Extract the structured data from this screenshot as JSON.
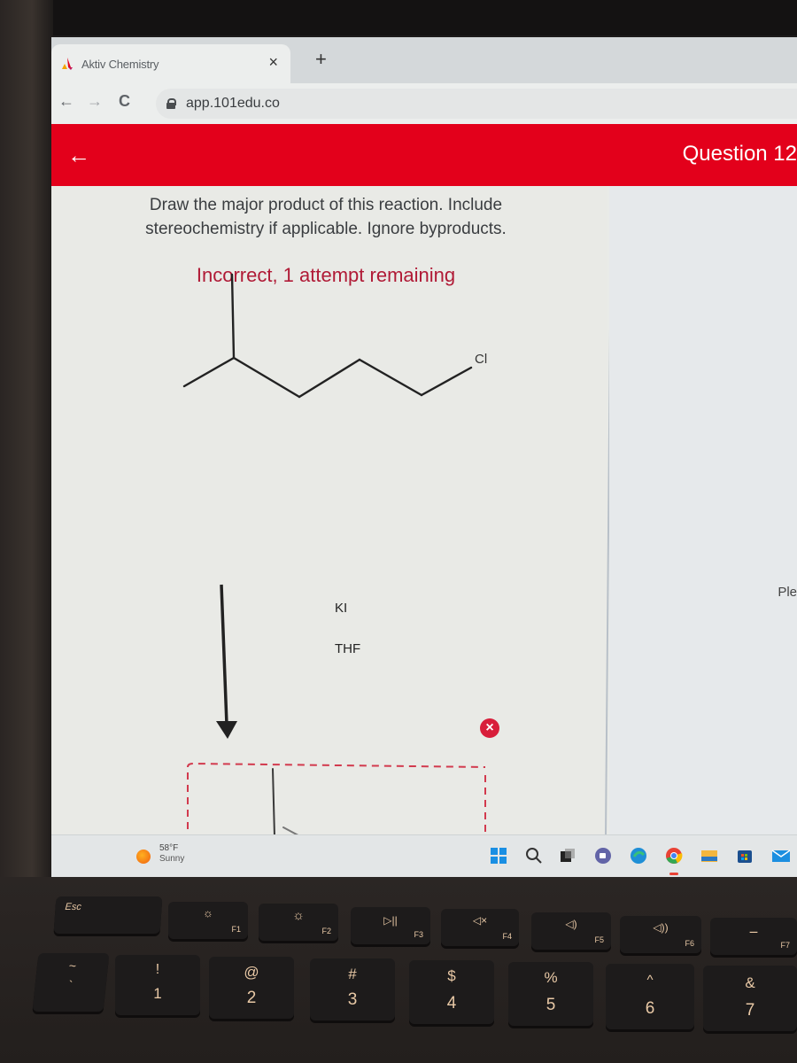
{
  "browser": {
    "tab_title": "Aktiv Chemistry",
    "tab_close": "×",
    "new_tab": "+",
    "back": "←",
    "forward": "→",
    "reload": "C",
    "url": "app.101edu.co"
  },
  "app_header": {
    "back": "←",
    "question_title": "Question 12"
  },
  "question": {
    "prompt": "Draw the major product of this reaction. Include stereochemistry if applicable. Ignore byproducts.",
    "status": "Incorrect, 1 attempt remaining",
    "reactant_label": "Cl",
    "reagents": [
      "KI",
      "THF"
    ],
    "remove_answer_icon": "×"
  },
  "right_panel": {
    "truncated_text": "Ple"
  },
  "taskbar": {
    "weather_temp": "58°F",
    "weather_condition": "Sunny",
    "icons": [
      "start-icon",
      "search-icon",
      "task-view-icon",
      "teams-chat-icon",
      "edge-icon",
      "chrome-icon",
      "file-explorer-icon",
      "store-icon",
      "mail-icon"
    ]
  },
  "keyboard": {
    "function_row": [
      {
        "name": "esc",
        "top": "Esc",
        "sub": ""
      },
      {
        "name": "f1",
        "top": "☼",
        "sub": "F1"
      },
      {
        "name": "f2",
        "top": "☼",
        "sub": "F2"
      },
      {
        "name": "f3",
        "top": "▷||",
        "sub": "F3"
      },
      {
        "name": "f4",
        "top": "◁×",
        "sub": "F4"
      },
      {
        "name": "f5",
        "top": "◁)",
        "sub": "F5"
      },
      {
        "name": "f6",
        "top": "◁))",
        "sub": "F6"
      },
      {
        "name": "f7",
        "top": "⚊",
        "sub": "F7"
      }
    ],
    "number_row": [
      {
        "name": "tilde",
        "top": "~",
        "main": "`"
      },
      {
        "name": "1",
        "top": "!",
        "main": "1"
      },
      {
        "name": "2",
        "top": "@",
        "main": "2"
      },
      {
        "name": "3",
        "top": "#",
        "main": "3"
      },
      {
        "name": "4",
        "top": "$",
        "main": "4"
      },
      {
        "name": "5",
        "top": "%",
        "main": "5"
      },
      {
        "name": "6",
        "top": "^",
        "main": "6"
      },
      {
        "name": "7",
        "top": "&",
        "main": "7"
      }
    ]
  },
  "colors": {
    "header_red": "#e3001b",
    "status_red": "#b01a36",
    "key_legend": "#e9c9a6"
  }
}
